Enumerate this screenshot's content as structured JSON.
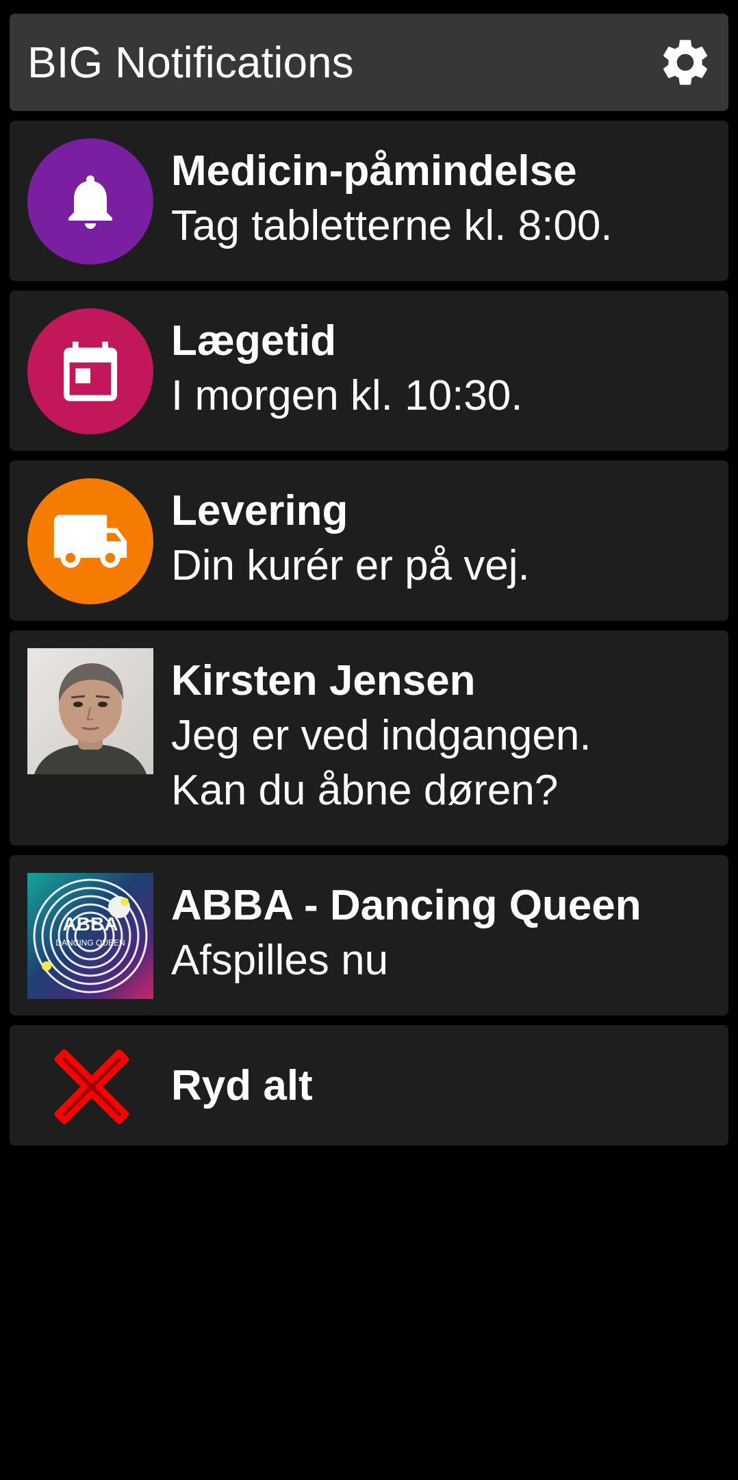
{
  "header": {
    "title": "BIG Notifications",
    "settings_icon": "gear-icon"
  },
  "notifications": [
    {
      "title": "Medicin-påmindelse",
      "body": [
        "Tag tabletterne kl. 8:00."
      ],
      "icon": "bell-icon",
      "icon_bg": "#7b1fa2"
    },
    {
      "title": "Lægetid",
      "body": [
        "I morgen kl. 10:30."
      ],
      "icon": "calendar-icon",
      "icon_bg": "#c2185b"
    },
    {
      "title": "Levering",
      "body": [
        "Din kurér er på vej."
      ],
      "icon": "truck-icon",
      "icon_bg": "#f57c00"
    },
    {
      "title": "Kirsten Jensen",
      "body": [
        "Jeg er ved indgangen.",
        "Kan du åbne døren?"
      ],
      "icon": "contact-photo"
    },
    {
      "title": "ABBA - Dancing Queen",
      "body": [
        "Afspilles nu"
      ],
      "icon": "album-art",
      "album_art_text": [
        "ABBA",
        "DANCING QUEEN"
      ]
    }
  ],
  "clear_all": {
    "label": "Ryd alt",
    "icon": "close-x-icon",
    "icon_color": "#ff0000"
  }
}
